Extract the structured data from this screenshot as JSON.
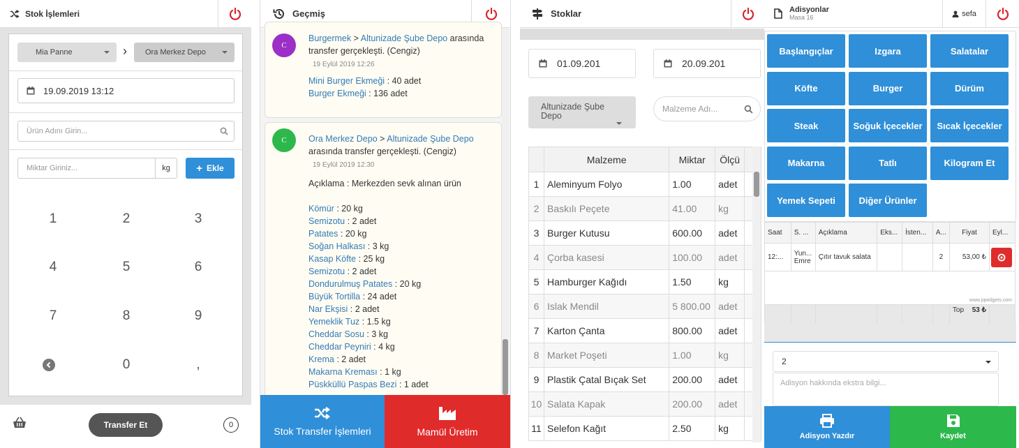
{
  "stock_ops": {
    "title": "Stok İşlemleri",
    "from_select": "Mia Panne",
    "to_select": "Ora Merkez Depo",
    "datetime": "19.09.2019 13:12",
    "product_placeholder": "Ürün Adını Girin...",
    "qty_placeholder": "Miktar Giriniz...",
    "unit": "kg",
    "add_label": "Ekle",
    "keys": [
      "1",
      "2",
      "3",
      "4",
      "5",
      "6",
      "7",
      "8",
      "9",
      "0",
      ","
    ],
    "transfer_label": "Transfer Et",
    "basket_count": "0"
  },
  "history": {
    "title": "Geçmiş",
    "entries": [
      {
        "avatar": "C",
        "from": "Burgermek",
        "sep": ">",
        "to": "Altunizade Şube Depo",
        "text_a": "arasında",
        "text_b": "transfer gerçekleşti. (Cengiz)",
        "date": "19 Eylül 2019 12:26",
        "items": [
          {
            "name": "Mini Burger Ekmeği",
            "qty": ": 40 adet"
          },
          {
            "name": "Burger Ekmeği",
            "qty": ": 136 adet"
          }
        ]
      },
      {
        "avatar": "C",
        "from": "Ora Merkez Depo",
        "sep": ">",
        "to": "Altunizade Şube Depo",
        "text_b": "arasında transfer gerçekleşti. (Cengiz)",
        "date": "19 Eylül 2019 12:30",
        "note": "Açıklama : Merkezden sevk alınan ürün",
        "items": [
          {
            "name": "Kömür",
            "qty": ": 20 kg"
          },
          {
            "name": "Semizotu",
            "qty": ": 2 adet"
          },
          {
            "name": "Patates",
            "qty": ": 20 kg"
          },
          {
            "name": "Soğan Halkası",
            "qty": ": 3 kg"
          },
          {
            "name": "Kasap Köfte",
            "qty": ": 25 kg"
          },
          {
            "name": "Semizotu",
            "qty": ": 2 adet"
          },
          {
            "name": "Dondurulmuş Patates",
            "qty": ": 20 kg"
          },
          {
            "name": "Büyük Tortilla",
            "qty": ": 24 adet"
          },
          {
            "name": "Nar Ekşisi",
            "qty": ": 2 adet"
          },
          {
            "name": "Yemeklik Tuz",
            "qty": ": 1.5 kg"
          },
          {
            "name": "Cheddar Sosu",
            "qty": ": 3 kg"
          },
          {
            "name": "Cheddar Peyniri",
            "qty": ": 4 kg"
          },
          {
            "name": "Krema",
            "qty": ": 2 adet"
          },
          {
            "name": "Makarna Kreması",
            "qty": ": 1 kg"
          },
          {
            "name": "Püskküllü Paspas Bezi",
            "qty": ": 1 adet"
          }
        ]
      }
    ],
    "btn_transfer": "Stok Transfer İşlemleri",
    "btn_production": "Mamül Üretim"
  },
  "stocks": {
    "title": "Stoklar",
    "date_from": "01.09.201",
    "date_to": "20.09.201",
    "depot": "Altunizade Şube Depo",
    "search_placeholder": "Malzeme Adı...",
    "columns": [
      "",
      "Malzeme",
      "Miktar",
      "Ölçü"
    ],
    "rows": [
      [
        "1",
        "Aleminyum Folyo",
        "1.00",
        "adet"
      ],
      [
        "2",
        "Baskılı Peçete",
        "41.00",
        "kg"
      ],
      [
        "3",
        "Burger Kutusu",
        "600.00",
        "adet"
      ],
      [
        "4",
        "Çorba kasesi",
        "100.00",
        "adet"
      ],
      [
        "5",
        "Hamburger Kağıdı",
        "1.50",
        "kg"
      ],
      [
        "6",
        "Islak Mendil",
        "5 800.00",
        "adet"
      ],
      [
        "7",
        "Karton Çanta",
        "800.00",
        "adet"
      ],
      [
        "8",
        "Market Poşeti",
        "1.00",
        "kg"
      ],
      [
        "9",
        "Plastik Çatal Bıçak Set",
        "200.00",
        "adet"
      ],
      [
        "10",
        "Salata Kapak",
        "200.00",
        "adet"
      ],
      [
        "11",
        "Selefon Kağıt",
        "2.50",
        "kg"
      ]
    ]
  },
  "adisyon": {
    "title": "Adisyonlar",
    "subtitle": "Masa 16",
    "user": "sefa",
    "categories": [
      "Başlangıçlar",
      "Izgara",
      "Salatalar",
      "Köfte",
      "Burger",
      "Dürüm",
      "Steak",
      "Soğuk İçecekler",
      "Sıcak İçecekler",
      "Makarna",
      "Tatlı",
      "Kilogram Et",
      "Yemek Sepeti",
      "Diğer Ürünler"
    ],
    "columns": [
      "Saat",
      "S. ...",
      "Açıklama",
      "Eks...",
      "İsten...",
      "A...",
      "Fiyat",
      "Eyl..."
    ],
    "order": {
      "time": "12:...",
      "staff": "Yun... Emre",
      "desc": "Çıtır tavuk salata",
      "qty": "2",
      "price": "53,00 ₺"
    },
    "watermark": "www.jqwidgets.com",
    "total_label": "Top",
    "total_value": "53 ₺",
    "count_select": "2",
    "note_placeholder": "Adisyon hakkında ekstra bilgi...",
    "print_label": "Adisyon Yazdır",
    "save_label": "Kaydet"
  },
  "colors": {
    "accent": "#2f8fd8",
    "danger": "#e02b2b",
    "success": "#2db84c",
    "power": "#d9232a"
  }
}
